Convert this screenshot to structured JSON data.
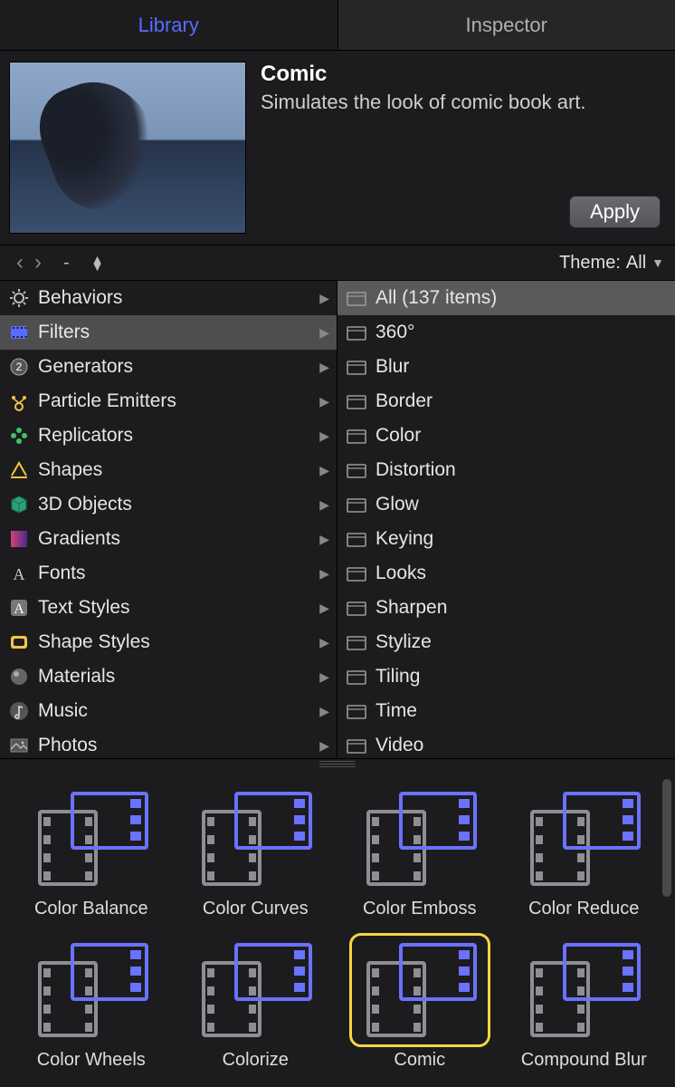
{
  "tabs": [
    {
      "label": "Library",
      "active": true
    },
    {
      "label": "Inspector",
      "active": false
    }
  ],
  "preview": {
    "title": "Comic",
    "description": "Simulates the look of comic book art.",
    "apply_label": "Apply"
  },
  "pathbar": {
    "back": "‹",
    "forward": "›",
    "segment": "-",
    "theme_label": "Theme:",
    "theme_value": "All"
  },
  "categories": [
    {
      "icon": "gear",
      "label": "Behaviors",
      "selected": false
    },
    {
      "icon": "filmstrip",
      "label": "Filters",
      "selected": true
    },
    {
      "icon": "generator",
      "label": "Generators",
      "selected": false
    },
    {
      "icon": "particle",
      "label": "Particle Emitters",
      "selected": false
    },
    {
      "icon": "replicator",
      "label": "Replicators",
      "selected": false
    },
    {
      "icon": "shape",
      "label": "Shapes",
      "selected": false
    },
    {
      "icon": "cube",
      "label": "3D Objects",
      "selected": false
    },
    {
      "icon": "gradient",
      "label": "Gradients",
      "selected": false
    },
    {
      "icon": "font",
      "label": "Fonts",
      "selected": false
    },
    {
      "icon": "textstyle",
      "label": "Text Styles",
      "selected": false
    },
    {
      "icon": "shapestyle",
      "label": "Shape Styles",
      "selected": false
    },
    {
      "icon": "material",
      "label": "Materials",
      "selected": false
    },
    {
      "icon": "music",
      "label": "Music",
      "selected": false
    },
    {
      "icon": "photos",
      "label": "Photos",
      "selected": false
    }
  ],
  "subcategories": [
    {
      "label": "All (137 items)",
      "selected": true
    },
    {
      "label": "360°"
    },
    {
      "label": "Blur"
    },
    {
      "label": "Border"
    },
    {
      "label": "Color"
    },
    {
      "label": "Distortion"
    },
    {
      "label": "Glow"
    },
    {
      "label": "Keying"
    },
    {
      "label": "Looks"
    },
    {
      "label": "Sharpen"
    },
    {
      "label": "Stylize"
    },
    {
      "label": "Tiling"
    },
    {
      "label": "Time"
    },
    {
      "label": "Video"
    }
  ],
  "items": [
    {
      "label": "Color Balance",
      "selected": false
    },
    {
      "label": "Color Curves",
      "selected": false
    },
    {
      "label": "Color Emboss",
      "selected": false
    },
    {
      "label": "Color Reduce",
      "selected": false
    },
    {
      "label": "Color Wheels",
      "selected": false
    },
    {
      "label": "Colorize",
      "selected": false
    },
    {
      "label": "Comic",
      "selected": true
    },
    {
      "label": "Compound Blur",
      "selected": false
    }
  ]
}
